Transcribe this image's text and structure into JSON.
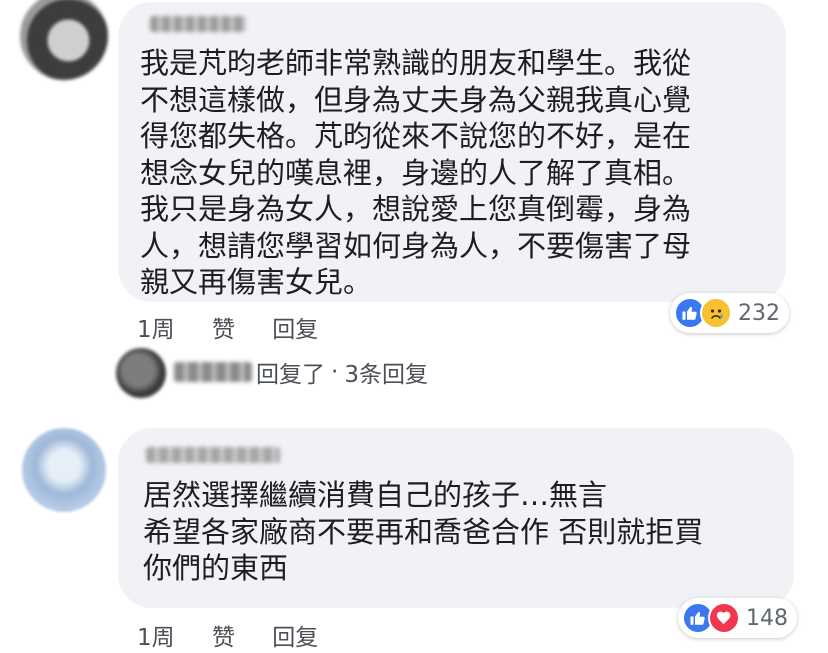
{
  "comments": [
    {
      "lines": [
        "我是芃昀老師非常熟識的朋友和學生。我從",
        "不想這樣做，但身為丈夫身為父親我真心覺",
        "得您都失格。芃昀從來不說您的不好，是在",
        "想念女兒的嘆息裡，身邊的人了解了真相。",
        "我只是身為女人，想說愛上您真倒霉，身為",
        "人，想請您學習如何身為人，不要傷害了母",
        "親又再傷害女兒。"
      ],
      "time": "1周",
      "like_label": "赞",
      "reply_label": "回复",
      "reaction_icons": [
        "like-icon",
        "sad-icon"
      ],
      "reaction_count": "232",
      "replies_summary": {
        "replied_text": "回复了",
        "separator": "·",
        "count_text": "3条回复"
      }
    },
    {
      "lines": [
        "居然選擇繼續消費自己的孩子…無言",
        "希望各家廠商不要再和喬爸合作 否則就拒買",
        "你們的東西"
      ],
      "time": "1周",
      "like_label": "赞",
      "reply_label": "回复",
      "reaction_icons": [
        "like-icon",
        "love-icon"
      ],
      "reaction_count": "148"
    }
  ],
  "colors": {
    "bubble": "#f1f2f6",
    "text": "#1c1e21",
    "meta": "#4b4f56",
    "like": "#3b78f0",
    "sad": "#f7c12f",
    "love": "#f0374f"
  }
}
